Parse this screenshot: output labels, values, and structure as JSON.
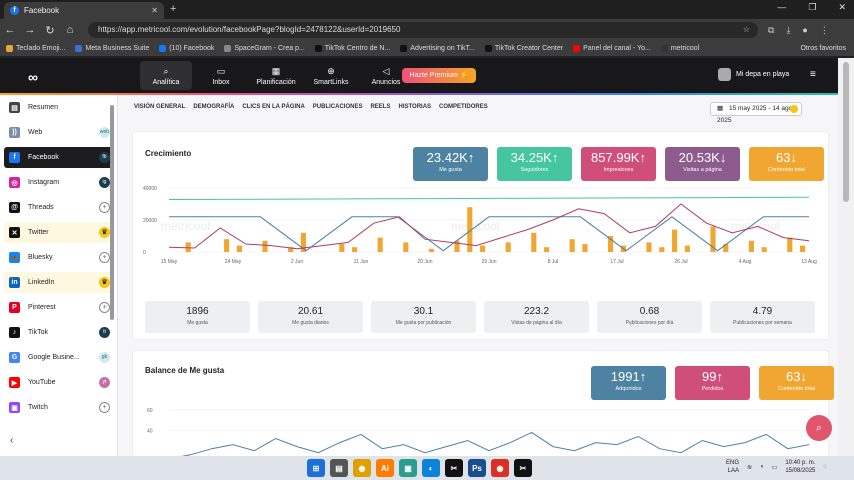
{
  "browser": {
    "tab_title": "Facebook",
    "url": "https://app.metricool.com/evolution/facebookPage?blogId=2478122&userId=2019650",
    "bookmarks": [
      "Teclado Emoji...",
      "Meta Business Suite",
      "(10) Facebook",
      "SpaceGram - Crea p...",
      "TikTok Centro de N...",
      "Advertising on TikT...",
      "TikTok Creator Center",
      "Panel del canal - Yo...",
      "metricool"
    ],
    "bookmark_colors": [
      "#e8a33a",
      "#3b6fd8",
      "#1877f2",
      "#888888",
      "#111111",
      "#111111",
      "#111111",
      "#ff0000",
      "#333333"
    ],
    "bookmarks_other": "Otros favoritos"
  },
  "topnav": {
    "items": [
      {
        "label": "Analítica",
        "icon": "magnifier-icon",
        "glyph": "⌕"
      },
      {
        "label": "Inbox",
        "icon": "chat-icon",
        "glyph": "▭"
      },
      {
        "label": "Planificación",
        "icon": "calendar-icon",
        "glyph": "▦"
      },
      {
        "label": "SmartLinks",
        "icon": "link-icon",
        "glyph": "⊕"
      },
      {
        "label": "Anuncios",
        "icon": "megaphone-icon",
        "glyph": "◁"
      }
    ],
    "premium": "Hazte Premium ⚡",
    "user": "Mi depa en playa"
  },
  "sidebar": {
    "items": [
      {
        "label": "Resumen",
        "icon": "summary-icon",
        "glyph": "▤",
        "color": "#444444",
        "badge": "",
        "badge_type": "none"
      },
      {
        "label": "Web",
        "icon": "rss-icon",
        "glyph": "))",
        "color": "#7a8fa6",
        "badge": "web",
        "badge_type": "soft"
      },
      {
        "label": "Facebook",
        "icon": "facebook-icon",
        "glyph": "f",
        "color": "#1877f2",
        "badge": "fb",
        "badge_type": "dark"
      },
      {
        "label": "Instagram",
        "icon": "instagram-icon",
        "glyph": "◎",
        "color": "#d6249f",
        "badge": "ig",
        "badge_type": "dark"
      },
      {
        "label": "Threads",
        "icon": "threads-icon",
        "glyph": "@",
        "color": "#111111",
        "badge": "+",
        "badge_type": "add"
      },
      {
        "label": "Twitter",
        "icon": "x-icon",
        "glyph": "✕",
        "color": "#111111",
        "badge": "♛",
        "badge_type": "crown"
      },
      {
        "label": "Bluesky",
        "icon": "bluesky-icon",
        "glyph": "🦋",
        "color": "#1185fe",
        "badge": "+",
        "badge_type": "add"
      },
      {
        "label": "LinkedIn",
        "icon": "linkedin-icon",
        "glyph": "in",
        "color": "#0a66c2",
        "badge": "♛",
        "badge_type": "crown"
      },
      {
        "label": "Pinterest",
        "icon": "pinterest-icon",
        "glyph": "P",
        "color": "#e60023",
        "badge": "+",
        "badge_type": "add"
      },
      {
        "label": "TikTok",
        "icon": "tiktok-icon",
        "glyph": "♪",
        "color": "#111111",
        "badge": "tt",
        "badge_type": "dark"
      },
      {
        "label": "Google Busine...",
        "icon": "google-business-icon",
        "glyph": "G",
        "color": "#4285f4",
        "badge": "gb",
        "badge_type": "soft"
      },
      {
        "label": "YouTube",
        "icon": "youtube-icon",
        "glyph": "▶",
        "color": "#ff0000",
        "badge": "yt",
        "badge_type": "pink"
      },
      {
        "label": "Twitch",
        "icon": "twitch-icon",
        "glyph": "▣",
        "color": "#9146ff",
        "badge": "+",
        "badge_type": "add"
      }
    ]
  },
  "subnav": [
    "VISIÓN GENERAL",
    "DEMOGRAFÍA",
    "CLICS EN LA PÁGINA",
    "PUBLICACIONES",
    "REELS",
    "HISTORIAS",
    "COMPETIDORES"
  ],
  "date_range": "15 may 2025 - 14 ago 2025",
  "growth": {
    "title": "Crecimiento",
    "kpis": [
      {
        "value": "23.42K",
        "arrow": "↑",
        "label": "Me gusta"
      },
      {
        "value": "34.25K",
        "arrow": "↑",
        "label": "Seguidores"
      },
      {
        "value": "857.99K",
        "arrow": "↑",
        "label": "Impresiones"
      },
      {
        "value": "20.53K",
        "arrow": "↓",
        "label": "Visitas a página"
      },
      {
        "value": "63",
        "arrow": "↓",
        "label": "Contenido total"
      }
    ],
    "stats": [
      {
        "value": "1896",
        "label": "Me gusta"
      },
      {
        "value": "20.61",
        "label": "Me gusta diarios"
      },
      {
        "value": "30.1",
        "label": "Me gusta por publicación"
      },
      {
        "value": "223.2",
        "label": "Vistas de página al día"
      },
      {
        "value": "0.68",
        "label": "Publicaciones por día"
      },
      {
        "value": "4.79",
        "label": "Publicaciones por semana"
      }
    ]
  },
  "balance": {
    "title": "Balance de Me gusta",
    "kpis": [
      {
        "value": "1991",
        "arrow": "↑",
        "label": "Adquiridos"
      },
      {
        "value": "99",
        "arrow": "↑",
        "label": "Perdidos"
      },
      {
        "value": "63",
        "arrow": "↓",
        "label": "Contenido total"
      }
    ]
  },
  "watermark": "metricool",
  "chart_data": [
    {
      "type": "line",
      "x_ticks": [
        "15 May",
        "24 May",
        "2 Jun",
        "11 Jun",
        "20 Jun",
        "29 Jun",
        "8 Jul",
        "17 Jul",
        "26 Jul",
        "4 Aug",
        "13 Aug"
      ],
      "y_ticks": [
        0,
        20000,
        40000
      ],
      "ylim": [
        0,
        40000
      ],
      "colors": {
        "followers": "#45c6a1",
        "impressions": "#b03a6a",
        "page_views": "#4d82a3",
        "posts": "#f0a631"
      },
      "followers": [
        32800,
        33000,
        33200,
        33400,
        33600,
        33800,
        34000,
        34250
      ],
      "impressions": [
        3000,
        2500,
        15000,
        5000,
        4000,
        2000,
        4000,
        6000,
        18000,
        22000,
        8000,
        6000,
        4000,
        9000,
        14000,
        20000,
        27000,
        24000,
        12000,
        16000,
        30000,
        18000,
        12000,
        16000,
        9000,
        7000
      ],
      "page_views": [
        22000,
        22000,
        22000,
        800,
        22000,
        22000,
        800,
        22000,
        22000,
        22000,
        800,
        22000,
        800,
        22000,
        22000
      ],
      "posts": [
        0,
        6000,
        0,
        0,
        8000,
        4000,
        0,
        7000,
        0,
        3000,
        12000,
        0,
        0,
        5000,
        3000,
        0,
        9000,
        0,
        6000,
        0,
        2000,
        0,
        7000,
        28000,
        4000,
        0,
        6000,
        0,
        12000,
        3000,
        0,
        8000,
        5000,
        0,
        10000,
        4000,
        0,
        6000,
        3000,
        14000,
        4000,
        0,
        16000,
        5000,
        0,
        7000,
        3000,
        0,
        9000,
        4000
      ]
    },
    {
      "type": "line",
      "title": "Balance de Me gusta",
      "y_ticks": [
        40,
        60
      ],
      "ylim": [
        0,
        65
      ],
      "colors": {
        "acquired": "#4d82a3",
        "posts": "#f0a631"
      },
      "acquired": [
        12,
        16,
        22,
        26,
        20,
        32,
        24,
        18,
        28,
        36,
        22,
        26,
        18,
        24,
        30,
        20,
        28,
        38,
        24,
        20,
        28,
        26,
        34,
        22,
        18,
        30,
        24,
        28,
        36,
        22,
        26
      ],
      "posts": [
        0,
        0,
        0,
        6,
        0,
        0,
        0,
        0,
        8,
        0,
        12,
        0,
        0,
        0,
        6,
        0,
        0,
        0,
        4,
        0,
        0,
        0,
        0,
        0,
        0,
        0,
        0,
        0,
        0,
        8,
        0
      ]
    }
  ],
  "taskbar": {
    "apps": [
      {
        "icon": "windows-start-icon",
        "glyph": "⊞",
        "color": "#1e6fd9"
      },
      {
        "icon": "explorer-icon",
        "glyph": "▤",
        "color": "#555555"
      },
      {
        "icon": "chrome-icon",
        "glyph": "◉",
        "color": "#e0a100"
      },
      {
        "icon": "illustrator-icon",
        "glyph": "Ai",
        "color": "#ff7c00"
      },
      {
        "icon": "photos-icon",
        "glyph": "▣",
        "color": "#2a9d8f"
      },
      {
        "icon": "edge-icon",
        "glyph": "◐",
        "color": "#0b83d9"
      },
      {
        "icon": "capcut-icon",
        "glyph": "✂",
        "color": "#111111"
      },
      {
        "icon": "photoshop-icon",
        "glyph": "Ps",
        "color": "#1a4e8f"
      },
      {
        "icon": "chrome-icon",
        "glyph": "◉",
        "color": "#d93025"
      },
      {
        "icon": "capcut-icon",
        "glyph": "✂",
        "color": "#111111"
      }
    ],
    "lang": "ENG",
    "lang2": "LAA",
    "time": "10:40 p. m.",
    "date": "15/08/2025"
  }
}
